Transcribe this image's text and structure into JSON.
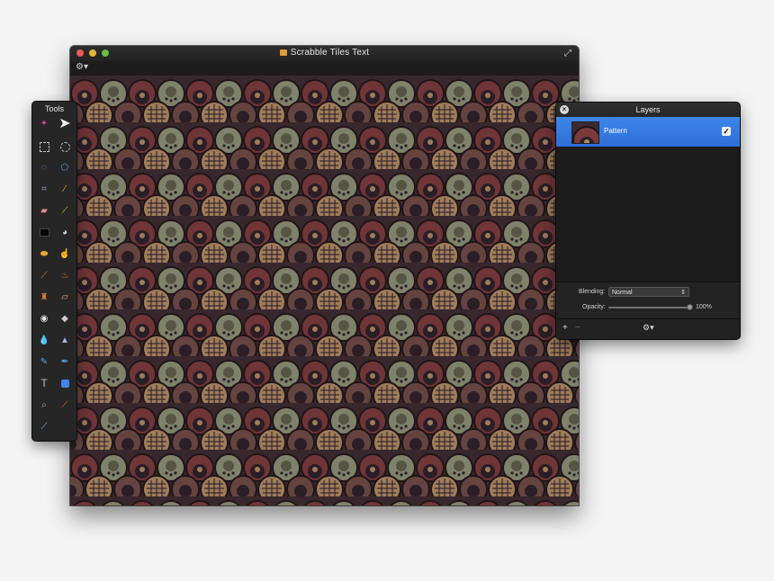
{
  "document": {
    "title": "Scrabble Tiles Text",
    "traffic_lights": [
      "close",
      "minimize",
      "zoom"
    ],
    "fullscreen_icon": "fullscreen-arrows-icon",
    "toolbar_icon": "gear-menu-icon"
  },
  "tools": {
    "title": "Tools",
    "items": [
      "magic-pointer-icon",
      "move-arrow-icon",
      "rect-select-icon",
      "ellipse-select-icon",
      "lasso-icon",
      "polygon-lasso-icon",
      "crop-icon",
      "eyedropper-icon",
      "eraser-icon",
      "pencil-icon",
      "fill-rect-icon",
      "paint-bucket-icon",
      "gradient-icon",
      "smudge-icon",
      "brush-icon",
      "burn-icon",
      "clone-stamp-icon",
      "bandage-icon",
      "redeye-icon",
      "dodge-icon",
      "blur-drop-icon",
      "sharpen-icon",
      "pen-icon",
      "freeform-pen-icon",
      "text-icon",
      "shape-icon",
      "zoom-icon",
      "color-picker-icon",
      "brush-stroke-icon"
    ]
  },
  "layers": {
    "title": "Layers",
    "items": [
      {
        "name": "Pattern",
        "visible": true,
        "selected": true
      }
    ],
    "blending_label": "Blending:",
    "blending_value": "Normal",
    "opacity_label": "Opacity:",
    "opacity_value": "100%",
    "opacity_fraction": 1.0,
    "footer": {
      "add": "+",
      "remove": "−",
      "gear": "⚙▾"
    }
  },
  "colors": {
    "accent_selection": "#2d6fd6",
    "pattern_dark": "#2b1f2a",
    "pattern_red": "#7a3a3c",
    "pattern_green": "#8b9176",
    "pattern_tan": "#b08a64"
  }
}
